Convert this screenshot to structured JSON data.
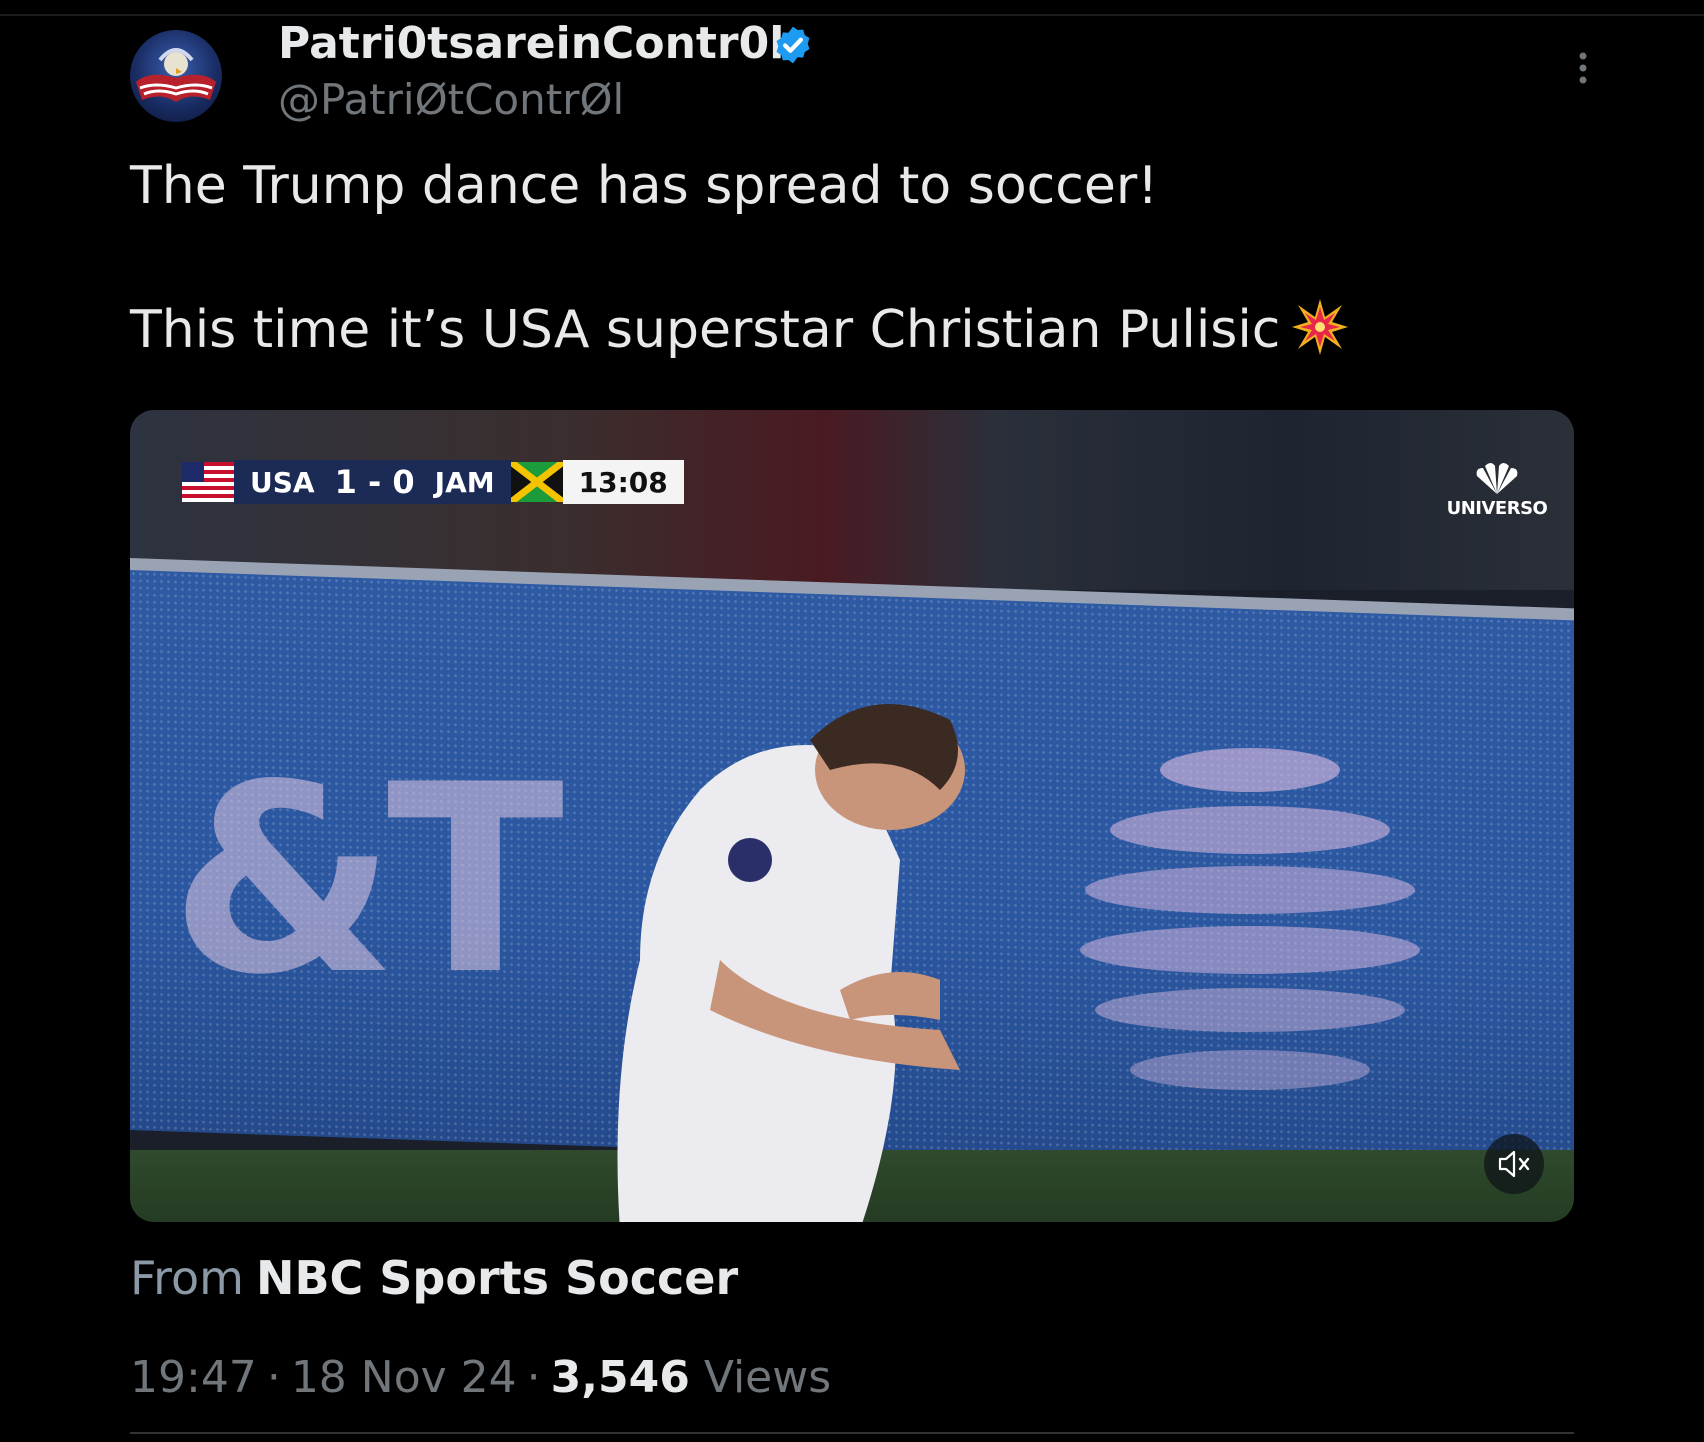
{
  "author": {
    "display_name": "Patri0tsareinContr0l",
    "handle": "@PatriØtContrØl",
    "verified": true,
    "avatar_icon": "eagle-flag-avatar"
  },
  "tweet": {
    "line1": "The Trump dance has spread to soccer!",
    "line2": "This time it’s USA superstar Christian Pulisic",
    "emoji_icon": "collision-emoji"
  },
  "media": {
    "scorebug": {
      "team_home": "USA",
      "score": "1 - 0",
      "team_away": "JAM",
      "clock": "13:08"
    },
    "network": "UNIVERSO",
    "board_text": "&T",
    "mute_icon": "muted-speaker-icon"
  },
  "attribution": {
    "prefix": "From",
    "source": "NBC Sports Soccer"
  },
  "meta": {
    "time": "19:47",
    "separator": "·",
    "date": "18 Nov 24",
    "views_count": "3,546",
    "views_label": "Views"
  },
  "colors": {
    "background": "#000000",
    "primary_text": "#e7e9ea",
    "secondary_text": "#71767b",
    "verified_blue": "#1d9bf0"
  }
}
